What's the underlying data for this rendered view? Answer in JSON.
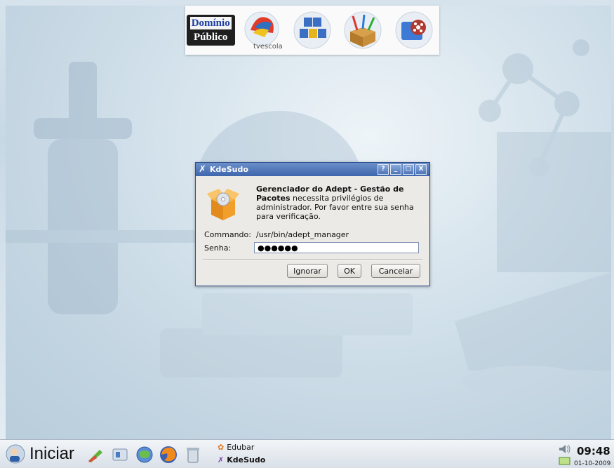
{
  "launcher": {
    "items": [
      {
        "name": "dominio-publico",
        "line1": "Domínio",
        "line2": "Público"
      },
      {
        "name": "tv-escola",
        "label": "tvescola"
      },
      {
        "name": "abc-blocks"
      },
      {
        "name": "art-box"
      },
      {
        "name": "film-reel"
      }
    ]
  },
  "dialog": {
    "title": "KdeSudo",
    "buttons": {
      "help": "?",
      "minimize": "_",
      "maximize": "□",
      "close": "X"
    },
    "message_bold": "Gerenciador do Adept - Gestão de Pacotes",
    "message_rest": " necessita privilégios de administrador. Por favor entre sua senha para verificação.",
    "command_label": "Commando:",
    "command_value": "/usr/bin/adept_manager",
    "password_label": "Senha:",
    "password_value": "●●●●●●",
    "ignore_label": "Ignorar",
    "ok_label": "OK",
    "cancel_label": "Cancelar"
  },
  "taskbar": {
    "start_label": "Iniciar",
    "tasks": [
      {
        "label": "Edubar"
      },
      {
        "label": "KdeSudo"
      }
    ],
    "clock": "09:48",
    "date": "01-10-2009"
  },
  "colors": {
    "titlebar": "#3e66ad",
    "dialog_bg": "#eceae6",
    "desktop": "#c7d8e5"
  }
}
